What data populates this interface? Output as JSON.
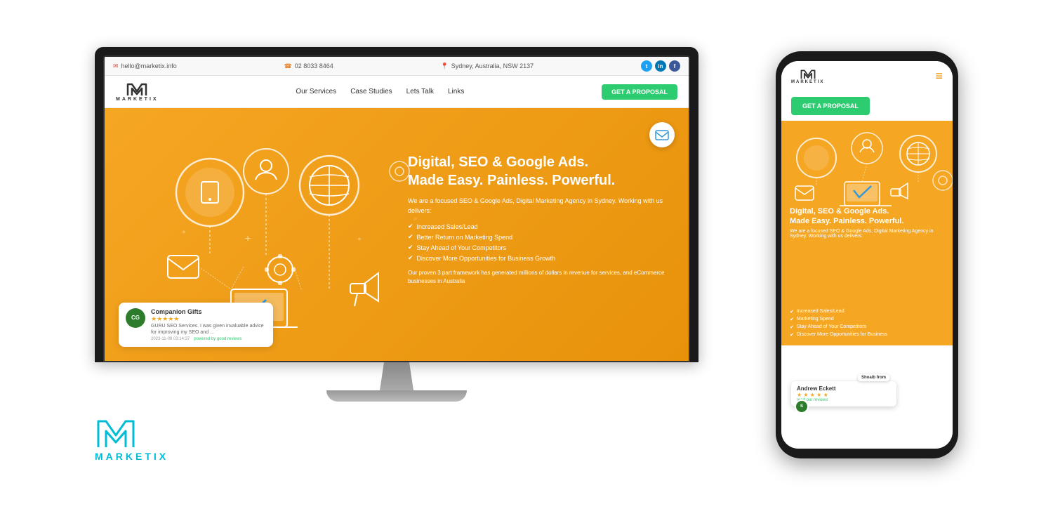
{
  "topbar": {
    "email": "hello@marketix.info",
    "phone": "02 8033 8464",
    "location": "Sydney, Australia, NSW 2137",
    "email_icon": "✉",
    "phone_icon": "☎",
    "location_icon": "📍"
  },
  "nav": {
    "logo_text": "MARKETIX",
    "links": [
      {
        "label": "Our Services"
      },
      {
        "label": "Case Studies"
      },
      {
        "label": "Lets Talk"
      },
      {
        "label": "Links"
      }
    ],
    "cta_label": "GET A PROPOSAL"
  },
  "hero": {
    "badge_icon": "✉",
    "title_line1": "Digital, SEO & Google Ads.",
    "title_line2": "Made Easy. Painless. Powerful.",
    "subtitle": "We are a focused SEO & Google Ads, Digital Marketing Agency in Sydney. Working with us delivers:",
    "bullets": [
      "Increased Sales/Lead",
      "Better Return on Marketing Spend",
      "Stay Ahead of Your Competitors",
      "Discover More Opportunities for Business Growth"
    ],
    "footer_text": "Our proven 3 part framework has generated millions of dollars in revenue for services, and eCommerce businesses in Australia"
  },
  "review": {
    "company": "Companion Gifts",
    "stars": "★★★★★",
    "text": "GURU SEO Services. I was given invaluable advice for improving my SEO and ...",
    "date": "2023-11-09 03:14:37",
    "powered_by": "powered by good.reviews",
    "avatar_initials": "CG"
  },
  "phone": {
    "logo_text": "MARKETIX",
    "hamburger": "≡",
    "cta_label": "GET A PROPOSAL",
    "hero_title_line1": "Digital, SEO & Google Ads.",
    "hero_title_line2": "Made Easy. Painless. Powerful.",
    "hero_subtitle": "We are a focused SEO & Google Ads, Digital Marketing Agency in Sydney. Working with us delivers:",
    "bullets": [
      "Increased Sales/Lead",
      "Marketing Spend",
      "Stay Ahead of Your Competitors",
      "Discover More Opportunities for Business"
    ],
    "review_name": "Andrew Eckett",
    "review_stars": "★ ★ ★ ★ ★",
    "review_link": "read our reviews",
    "shoaib_label": "Shoaib from",
    "shoaib_avatar": "S"
  },
  "bottom_logo": {
    "text": "MARKETIX"
  },
  "colors": {
    "orange": "#f5a623",
    "green": "#2ecc71",
    "cyan": "#00bcd4",
    "dark": "#1a1a1a",
    "white": "#ffffff"
  }
}
